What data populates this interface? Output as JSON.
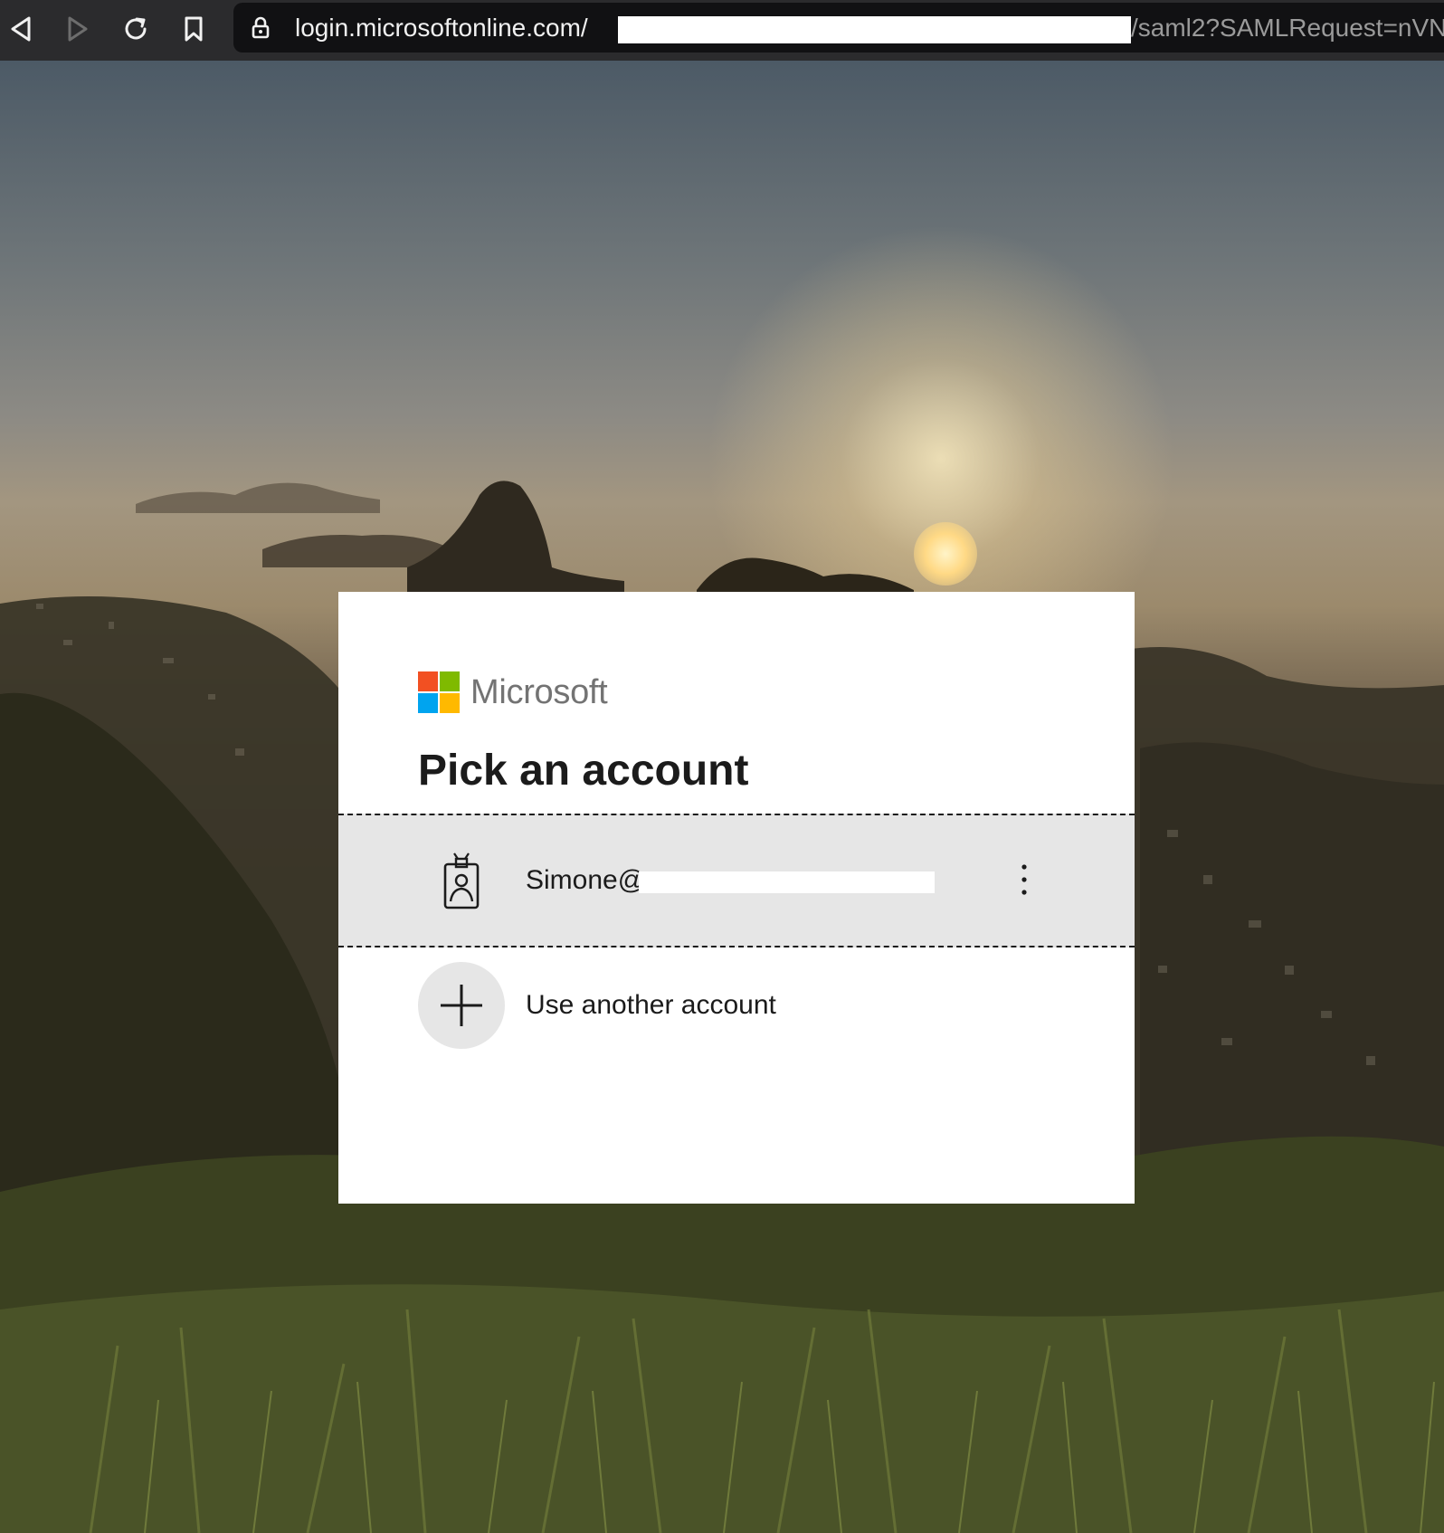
{
  "browser": {
    "url_host": "login.microsoftonline.com/",
    "url_path": "/saml2?SAMLRequest=nVN",
    "icons": [
      "back-icon",
      "forward-icon",
      "reload-icon",
      "bookmark-icon",
      "lock-icon"
    ]
  },
  "card": {
    "brand": "Microsoft",
    "title": "Pick an account",
    "account": {
      "email": "Simone@",
      "icon": "badge-person-icon",
      "menu_icon": "more-vertical-icon"
    },
    "another_account": {
      "label": "Use another account",
      "icon": "plus-icon"
    }
  },
  "colors": {
    "ms_red": "#f25022",
    "ms_green": "#7fba00",
    "ms_blue": "#00a4ef",
    "ms_yellow": "#ffb900",
    "selected_row_bg": "#e6e6e6",
    "toolbar_bg": "#2b2b2d"
  }
}
